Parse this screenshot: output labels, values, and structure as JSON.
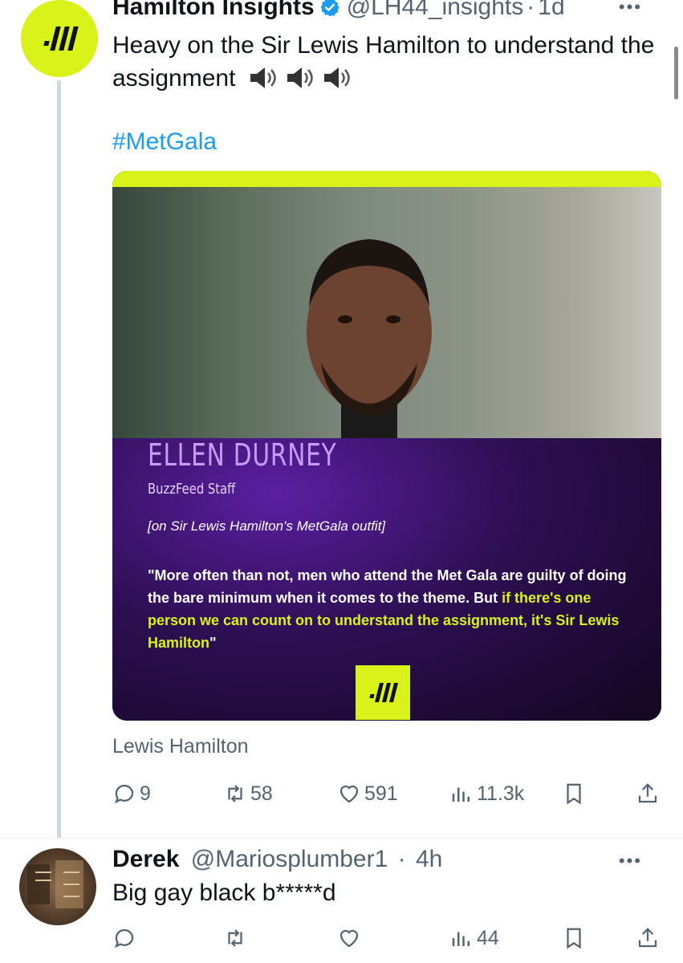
{
  "main_post": {
    "display_name": "Hamilton Insights",
    "handle": "@LH44_insights",
    "separator": "·",
    "time": "1d",
    "more_label": "•••",
    "text": "Heavy on the Sir Lewis Hamilton to understand the assignment",
    "emoji_icons": [
      "speaker-icon",
      "speaker-icon",
      "speaker-icon"
    ],
    "hashtag": "#MetGala",
    "media": {
      "name": "ELLEN DURNEY",
      "role": "BuzzFeed Staff",
      "context": "[on Sir Lewis Hamilton's MetGala outfit]",
      "quote_plain": "\"More often than not, men who attend the Met Gala are guilty of doing the bare minimum when it comes to the theme. But ",
      "quote_highlight": "if there's one person we can count on to understand the assignment, it's Sir Lewis Hamilton",
      "quote_end": "\""
    },
    "caption": "Lewis Hamilton",
    "stats": {
      "replies": "9",
      "reposts": "58",
      "likes": "591",
      "views": "11.3k"
    }
  },
  "reply_post": {
    "display_name": "Derek",
    "handle": "@Mariosplumber1",
    "separator": "·",
    "time": "4h",
    "more_label": "•••",
    "text": "Big gay black b*****d",
    "stats": {
      "replies": "",
      "reposts": "",
      "likes": "",
      "views": "44"
    }
  },
  "colors": {
    "brand_lime": "#d9f21a",
    "link_blue": "#1d9bf0",
    "muted_text": "#536471",
    "panel_purple": "#2d0f52",
    "name_purple": "#c69cff"
  }
}
